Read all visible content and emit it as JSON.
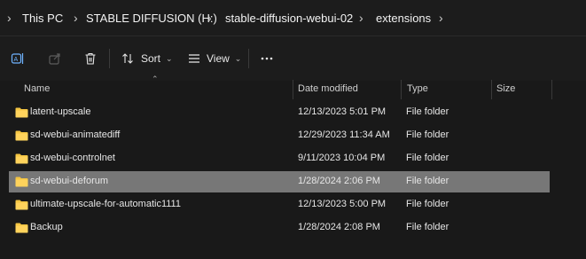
{
  "breadcrumb": {
    "items": [
      "This PC",
      "STABLE DIFFUSION (H:)",
      "stable-diffusion-webui-02",
      "extensions"
    ]
  },
  "toolbar": {
    "sort_label": "Sort",
    "view_label": "View",
    "icons": [
      "rename-icon",
      "share-icon",
      "delete-icon",
      "sort-icon",
      "view-icon",
      "more-icon"
    ]
  },
  "columns": {
    "name": "Name",
    "date_modified": "Date modified",
    "type": "Type",
    "size": "Size"
  },
  "files": [
    {
      "name": "latent-upscale",
      "date": "12/13/2023 5:01 PM",
      "type": "File folder"
    },
    {
      "name": "sd-webui-animatediff",
      "date": "12/29/2023 11:34 AM",
      "type": "File folder"
    },
    {
      "name": "sd-webui-controlnet",
      "date": "9/11/2023 10:04 PM",
      "type": "File folder"
    },
    {
      "name": "sd-webui-deforum",
      "date": "1/28/2024 2:06 PM",
      "type": "File folder",
      "selected": true
    },
    {
      "name": "ultimate-upscale-for-automatic1111",
      "date": "12/13/2023 5:00 PM",
      "type": "File folder"
    },
    {
      "name": "Backup",
      "date": "1/28/2024 2:08 PM",
      "type": "File folder"
    }
  ],
  "colors": {
    "background": "#191919",
    "selected_row": "#777777",
    "folder": "#f4c542"
  }
}
